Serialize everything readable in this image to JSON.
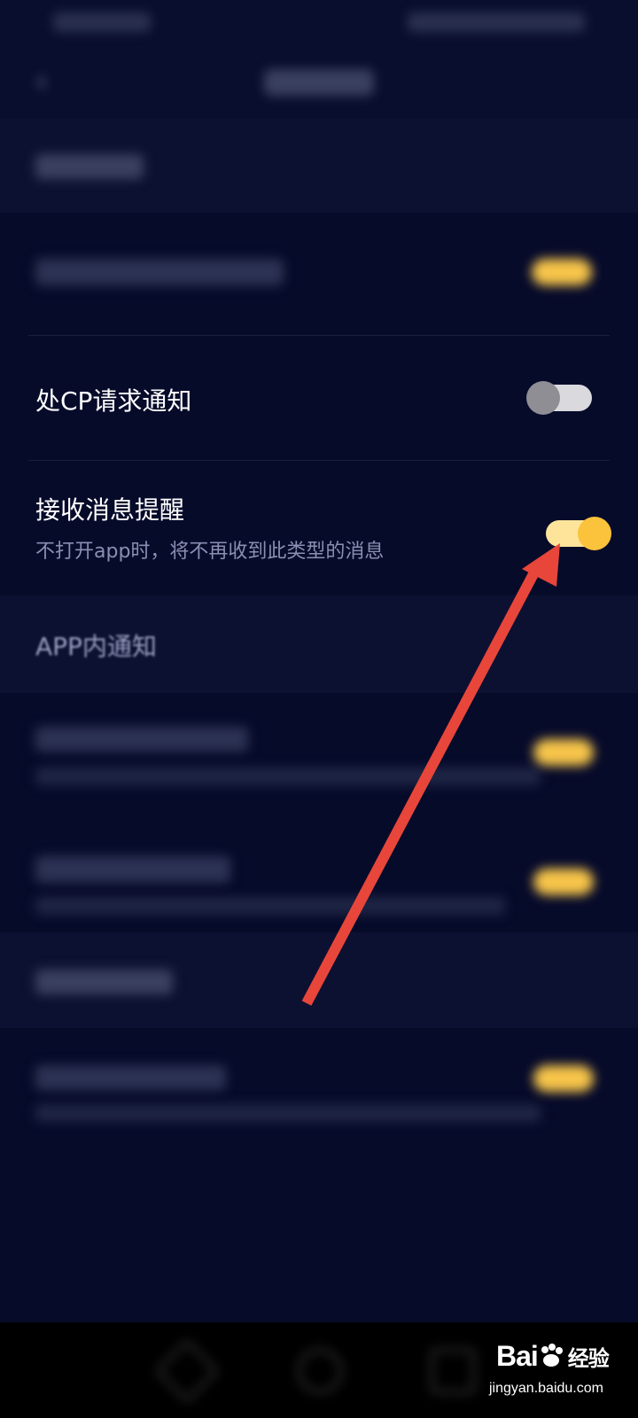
{
  "settings": {
    "cp_request": {
      "title": "处CP请求通知",
      "enabled": false
    },
    "message_reminder": {
      "title": "接收消息提醒",
      "subtitle": "不打开app时，将不再收到此类型的消息",
      "enabled": true
    },
    "in_app_section": {
      "title": "APP内通知"
    }
  },
  "icons": {
    "back": "chevron-left-icon",
    "nav_back": "nav-back-icon",
    "nav_home": "nav-home-icon",
    "nav_recent": "nav-recent-icon",
    "paw": "paw-icon"
  },
  "watermark": {
    "brand": "Bai",
    "brand_cn": "经验",
    "url": "jingyan.baidu.com"
  },
  "colors": {
    "background": "#070b2a",
    "toggle_on": "#fbc23c",
    "toggle_off": "#8e8e94",
    "annotation_arrow": "#e8463a"
  }
}
